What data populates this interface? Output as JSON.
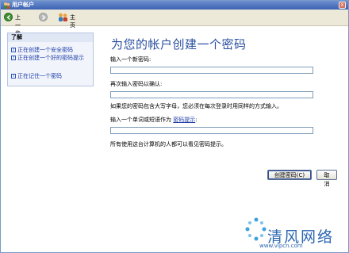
{
  "window": {
    "title": "用户帐户",
    "close_glyph": "x"
  },
  "nav": {
    "back_label": "上一步",
    "home_label": "主页"
  },
  "sidebar": {
    "heading": "了解",
    "items": [
      {
        "label": "正在创建一个安全密码"
      },
      {
        "label": "正在创建一个好的密码提示"
      },
      {
        "label": "正在记住一个密码"
      }
    ]
  },
  "main": {
    "title": "为您的帐户创建一个密码",
    "new_password_label": "输入一个新密码:",
    "new_password_value": "",
    "confirm_label": "再次输入密码以确认:",
    "confirm_value": "",
    "case_note": "如果您的密码包含大写字母，您必须在每次登录时用同样的方式输入。",
    "hint_prompt": "输入一个单词或短语作为",
    "hint_link": "密码提示",
    "hint_colon": ":",
    "hint_value": "",
    "visibility_note": "所有使用这台计算机的人都可以看见密码提示。"
  },
  "buttons": {
    "create_label": "创建密码(C)",
    "cancel_label": "取消"
  },
  "watermark": {
    "name": "清风网络",
    "url": "www.vipcn.com"
  },
  "colors": {
    "title_blue": "#2a4ea0",
    "link_blue": "#1d3da8",
    "titlebar_blue": "#3b62b2",
    "nav_bg": "#ece9d8"
  }
}
